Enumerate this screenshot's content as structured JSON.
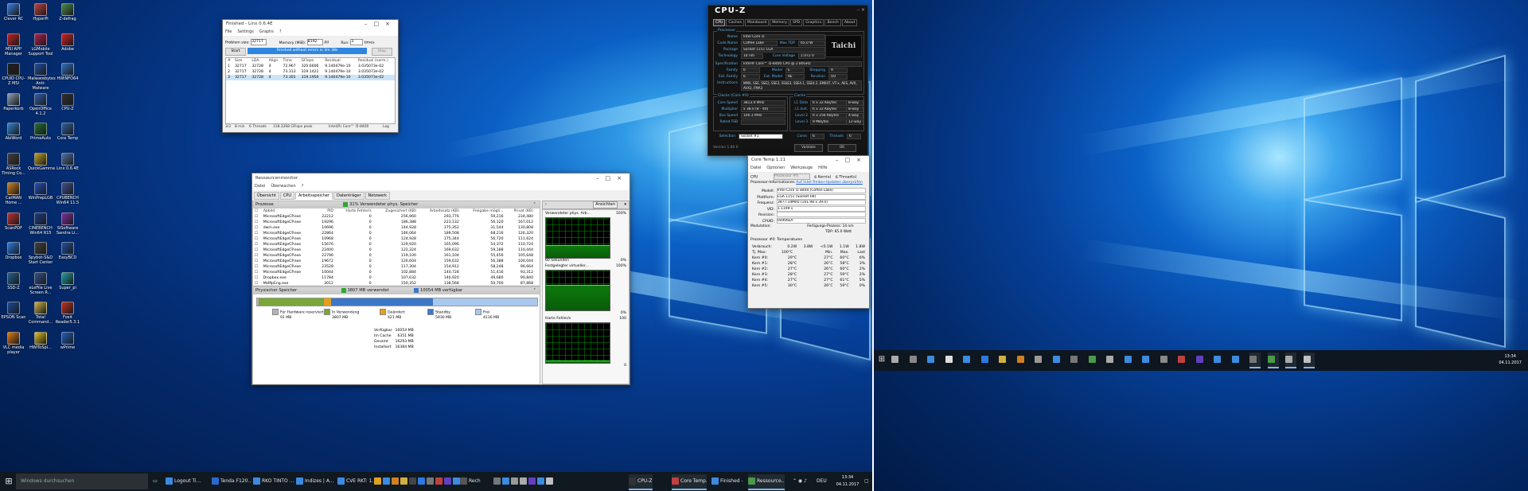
{
  "desktop_icons": [
    {
      "label": "Clever RC",
      "color": "#3a7ad8"
    },
    {
      "label": "HyperPi",
      "color": "#c04040"
    },
    {
      "label": "Z-defrag",
      "color": "#4a8a4a"
    },
    {
      "label": "MSI APP Manager",
      "color": "#c02020"
    },
    {
      "label": "LGMobile Support Tool",
      "color": "#b02050"
    },
    {
      "label": "Adobe",
      "color": "#d02020"
    },
    {
      "label": "CPUID CPU-Z MSI",
      "color": "#202020"
    },
    {
      "label": "Malwarebytes Anti-Malware",
      "color": "#2050a0"
    },
    {
      "label": "HWiNFO64",
      "color": "#3070c0"
    },
    {
      "label": "Paperkorb",
      "color": "#90a0b0"
    },
    {
      "label": "OpenOffice 4.1.2",
      "color": "#3060b0"
    },
    {
      "label": "CPU-Z",
      "color": "#303030"
    },
    {
      "label": "AbiWord",
      "color": "#3080d0"
    },
    {
      "label": "PrimeAuto",
      "color": "#207030"
    },
    {
      "label": "Core Temp",
      "color": "#3060a0"
    },
    {
      "label": "ASRock Timing Co...",
      "color": "#404040"
    },
    {
      "label": "QuickGamma",
      "color": "#c0a020"
    },
    {
      "label": "Linx 0.6.4E",
      "color": "#5070a0"
    },
    {
      "label": "CatMAN Home ...",
      "color": "#d08020"
    },
    {
      "label": "WinPrepLGB",
      "color": "#2050c0"
    },
    {
      "label": "CPUBENCH Win64 11.5",
      "color": "#405090"
    },
    {
      "label": "ScanPDF",
      "color": "#c03030"
    },
    {
      "label": "CINEBENCH Win64 R15",
      "color": "#1a3a8a"
    },
    {
      "label": "SiSoftware Sandra Li...",
      "color": "#8030a0"
    },
    {
      "label": "Dropbox",
      "color": "#2a7ae0"
    },
    {
      "label": "Spybot-S&D Start Center",
      "color": "#404040"
    },
    {
      "label": "EasyBCD",
      "color": "#2050a0"
    },
    {
      "label": "SSD-Z",
      "color": "#206090"
    },
    {
      "label": "eLeFile Live Screen R...",
      "color": "#305090"
    },
    {
      "label": "Super_pi",
      "color": "#20a0a0"
    },
    {
      "label": "EPSON Scan",
      "color": "#1a4a9a"
    },
    {
      "label": "Total Command...",
      "color": "#d0b040"
    },
    {
      "label": "Foxit Reader5.3.1",
      "color": "#c03020"
    },
    {
      "label": "VLC media player",
      "color": "#e07810"
    },
    {
      "label": "HWiToSpi...",
      "color": "#e0c020"
    },
    {
      "label": "wPrime",
      "color": "#2060c0"
    }
  ],
  "taskbar1": {
    "search_placeholder": "Windows durchsuchen",
    "buttons": [
      "Logout Ti...",
      "Tenda F120...",
      "RKO TINTO ...",
      "Indizes | A...",
      "CVE RKT: 1...",
      "Rechner",
      "CPU-Z",
      "Core Temp...",
      "Finished - ...",
      "Ressource..."
    ],
    "lang": "DEU",
    "time": "13:34",
    "date": "04.11.2017"
  },
  "taskbar2": {
    "time": "13:34",
    "date": "04.11.2017"
  },
  "linx": {
    "title": "Finished - Linx 0.6.4E",
    "menu": [
      "File",
      "Settings",
      "Graphs",
      "?"
    ],
    "problem_label": "Problem size:",
    "problem_value": "32717",
    "memory_label": "Memory (MiB):",
    "memory_value": "8192",
    "all_label": "All",
    "run_label": "Run:",
    "run_value": "3",
    "times_label": "times",
    "start_label": "Start",
    "status": "Finished without errors in 3m 38s",
    "stop_label": "Stop",
    "columns": [
      "#",
      "Size",
      "LDA",
      "Align",
      "Time",
      "GFlops",
      "Residual",
      "Residual (norm.)"
    ],
    "rows": [
      [
        "1",
        "32717",
        "32728",
        "4",
        "72.967",
        "320.6606",
        "9.140479e-10",
        "3.035073e-02"
      ],
      [
        "2",
        "32717",
        "32728",
        "4",
        "73.313",
        "319.1421",
        "9.140479e-10",
        "3.035073e-02"
      ],
      [
        "3",
        "32717",
        "32728",
        "4",
        "73.301",
        "319.1950",
        "9.140479e-10",
        "3.035073e-02"
      ]
    ],
    "footer": [
      "3/3",
      "8 min",
      "6 Threads",
      "318.3268 GFlops peak",
      "Intel(R) Core™ i5-8400",
      "Log"
    ]
  },
  "cpuz": {
    "title": "CPU-Z",
    "tabs": [
      "CPU",
      "Caches",
      "Mainboard",
      "Memory",
      "SPD",
      "Graphics",
      "Bench",
      "About"
    ],
    "processor_legend": "Processor",
    "name_label": "Name",
    "name": "Intel Core i5",
    "codename_label": "Code Name",
    "codename": "Coffee Lake",
    "maxtdp_label": "Max TDP",
    "maxtdp": "65.0 W",
    "package_label": "Package",
    "package": "Socket 1151 LGA",
    "technology_label": "Technology",
    "technology": "14 nm",
    "corevoltage_label": "Core Voltage",
    "corevoltage": "1.072 V",
    "spec_label": "Specification",
    "spec": "Intel® Core™ i5-8400 CPU @ 2.80GHz",
    "family_label": "Family",
    "family": "6",
    "model_label": "Model",
    "model": "E",
    "stepping_label": "Stepping",
    "stepping": "A",
    "extfamily_label": "Ext. Family",
    "extfamily": "6",
    "extmodel_label": "Ext. Model",
    "extmodel": "9E",
    "revision_label": "Revision",
    "revision": "U0",
    "instr_label": "Instructions",
    "instr": "MMX, SSE, SSE2, SSE3, SSSE3, SSE4.1, SSE4.2, EM64T, VT-x, AES, AVX, AVX2, FMA3",
    "clocks_legend": "Clocks (Core #0)",
    "corespeed_label": "Core Speed",
    "corespeed": "3813.4 MHz",
    "multiplier_label": "Multiplier",
    "multiplier": "x 38.0 (8 - 40)",
    "busspeed_label": "Bus Speed",
    "busspeed": "100.3 MHz",
    "ratedfsb_label": "Rated FSB",
    "ratedfsb": "",
    "cache_legend": "Cache",
    "l1d_label": "L1 Data",
    "l1d": "6 x 32 KBytes",
    "l1d_way": "8-way",
    "l1i_label": "L1 Inst.",
    "l1i": "6 x 32 KBytes",
    "l1i_way": "8-way",
    "l2_label": "Level 2",
    "l2": "6 x 256 KBytes",
    "l2_way": "4-way",
    "l3_label": "Level 3",
    "l3": "9 MBytes",
    "l3_way": "12-way",
    "selection_label": "Selection",
    "selection": "Socket #1",
    "cores_label": "Cores",
    "cores": "6",
    "threads_label": "Threads",
    "threads": "6",
    "version": "Version 1.80.0",
    "validate_label": "Validate",
    "ok_label": "OK",
    "brand": "Taichi"
  },
  "resmon": {
    "title": "Ressourcenmonitor",
    "menu": [
      "Datei",
      "Überwachen",
      "?"
    ],
    "tabs": [
      "Übersicht",
      "CPU",
      "Arbeitsspeicher",
      "Datenträger",
      "Netzwerk"
    ],
    "proc_header": "Prozesse",
    "proc_badge": "31% Verwendeter phys. Speicher",
    "columns": [
      "Abbild",
      "PID",
      "Harte Fehler/s",
      "Zugesichert (KB)",
      "Arbeitssatz (KB)",
      "Freigabe mögli...",
      "Privat (KB)"
    ],
    "rows": [
      [
        "MicrosoftEdgeCP.exe",
        "22212",
        "0",
        "256,960",
        "293,776",
        "59,216",
        "234,480"
      ],
      [
        "MicrosoftEdgeCP.exe",
        "19296",
        "0",
        "186,388",
        "223,132",
        "56,120",
        "167,012"
      ],
      [
        "dwm.exe",
        "10696",
        "0",
        "144,928",
        "175,352",
        "31,544",
        "130,808"
      ],
      [
        "MicrosoftEdgeCP.exe",
        "22864",
        "0",
        "146,064",
        "189,508",
        "68,216",
        "126,320"
      ],
      [
        "MicrosoftEdgeCP.exe",
        "10968",
        "0",
        "124,928",
        "175,344",
        "56,720",
        "111,624"
      ],
      [
        "MicrosoftEdgeCP.exe",
        "15676",
        "0",
        "129,920",
        "165,096",
        "54,372",
        "110,724"
      ],
      [
        "MicrosoftEdgeCP.exe",
        "22400",
        "0",
        "122,324",
        "169,632",
        "59,188",
        "110,444"
      ],
      [
        "MicrosoftEdgeCP.exe",
        "22796",
        "0",
        "119,100",
        "161,104",
        "55,456",
        "105,648"
      ],
      [
        "MicrosoftEdgeCP.exe",
        "19672",
        "0",
        "120,604",
        "159,632",
        "56,388",
        "100,044"
      ],
      [
        "MicrosoftEdgeCP.exe",
        "23528",
        "0",
        "117,304",
        "154,912",
        "58,248",
        "96,664"
      ],
      [
        "MicrosoftEdgeCP.exe",
        "10044",
        "0",
        "102,884",
        "144,728",
        "51,416",
        "93,312"
      ],
      [
        "Dropbox.exe",
        "11784",
        "0",
        "107,632",
        "140,920",
        "49,680",
        "90,840"
      ],
      [
        "MsMpEng.exe",
        "3012",
        "0",
        "150,352",
        "138,568",
        "50,700",
        "87,868"
      ],
      [
        "MicrosoftEdgeCP.exe",
        "18964",
        "0",
        "95,868",
        "140,548",
        "54,080",
        "86,468"
      ]
    ],
    "phys_header": "Physischer Speicher",
    "phys_used": "3807 MB verwendet",
    "phys_avail": "10054 MB verfügbar",
    "legend": [
      {
        "label": "Für Hardware reserviert",
        "value": "91 MB",
        "color": "#b4b4b4"
      },
      {
        "label": "In Verwendung",
        "value": "3807 MB",
        "color": "#7aa63a"
      },
      {
        "label": "Geändert",
        "value": "421 MB",
        "color": "#e6a020"
      },
      {
        "label": "Standby",
        "value": "5930 MB",
        "color": "#3c78c8"
      },
      {
        "label": "Frei",
        "value": "4116 MB",
        "color": "#a8c8ee"
      }
    ],
    "summary": [
      [
        "Verfügbar",
        "10054 MB"
      ],
      [
        "Im Cache",
        "6351 MB"
      ],
      [
        "Gesamt",
        "16293 MB"
      ],
      [
        "Installiert",
        "16384 MB"
      ]
    ],
    "bar_fractions": [
      0.0056,
      0.2337,
      0.0258,
      0.364,
      0.3709
    ],
    "views_label": "Ansichten",
    "graph1_title": "Verwendeter phys. Arb...",
    "graph1_pct": "100%",
    "graph1_foot": "60 Sekunden",
    "graph1_foot_pct": "0%",
    "graph2_title": "Festgelegter virtueller...",
    "graph2_pct": "100%",
    "graph2_foot_pct": "0%",
    "graph3_title": "Harte Fehler/s",
    "graph3_pct": "100",
    "graph3_foot_pct": "0",
    "graph_levels": [
      0.31,
      0.62,
      0.04
    ]
  },
  "coretemp": {
    "title": "Core Temp 1.11",
    "menu": [
      "Datei",
      "Optionen",
      "Werkzeuge",
      "Hilfe"
    ],
    "cpu_label": "CPU",
    "cpu_select": "Prozessor #0",
    "cores_label": "6",
    "cores_suffix": "Kern(e)",
    "threads_label": "6",
    "threads_suffix": "Thread(s)",
    "info_label": "Prozessor-Informationen",
    "update_link": "Auf Intel-Treiber-Updates überprüfen",
    "fields": [
      [
        "Modell:",
        "Intel Core i5 8400 (Coffee Lake)"
      ],
      [
        "Plattform:",
        "LGA 1151 (Socket H4)"
      ],
      [
        "Frequenz:",
        "3977.14MHz (101.98 x 39.0)"
      ],
      [
        "VID:",
        "1.1199 v"
      ],
      [
        "Revision:",
        ""
      ],
      [
        "CPUID:",
        "0x906EA"
      ]
    ],
    "modulation_label": "Modulation:",
    "lithography_label": "Fertigungs-Prozess:",
    "lithography": "14 nm",
    "tdp_label": "TDP:",
    "tdp": "65.0 Watt",
    "temps_label": "Prozessor #0: Temperaturen",
    "power_label": "Verbrauch:",
    "power": [
      "0.2W",
      "3.8W",
      "<0.1W",
      "1.1W",
      "1.8W"
    ],
    "tjmax_label": "Tj. Max:",
    "tjmax": "100°C",
    "col_min": "Min.",
    "col_max": "Max.",
    "col_last": "Last",
    "cores": [
      [
        "Kern #0:",
        "29°C",
        "27°C",
        "60°C",
        "6%"
      ],
      [
        "Kern #1:",
        "28°C",
        "26°C",
        "58°C",
        "3%"
      ],
      [
        "Kern #2:",
        "27°C",
        "26°C",
        "60°C",
        "2%"
      ],
      [
        "Kern #3:",
        "28°C",
        "27°C",
        "59°C",
        "2%"
      ],
      [
        "Kern #4:",
        "27°C",
        "27°C",
        "61°C",
        "5%"
      ],
      [
        "Kern #5:",
        "30°C",
        "26°C",
        "59°C",
        "0%"
      ]
    ]
  }
}
